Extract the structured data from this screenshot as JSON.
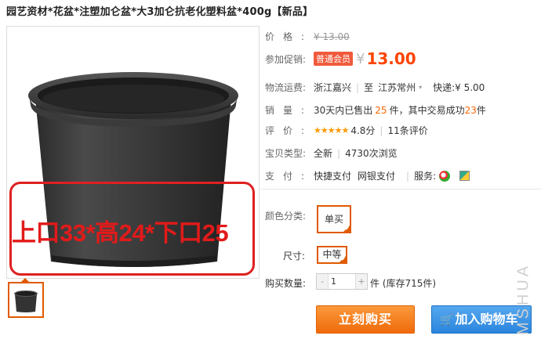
{
  "title": "园艺资材*花盆*注塑加仑盆*大3加仑抗老化塑料盆*400g【新品】",
  "image": {
    "overlay_text": "上口33*高24*下口25"
  },
  "details": {
    "price": {
      "label": "价格:",
      "value": "¥ 13.00"
    },
    "promo": {
      "label": "参加促销:",
      "badge": "普通会员",
      "currency": "¥",
      "value": "13.00"
    },
    "shipping": {
      "label": "物流运费:",
      "from": "浙江嘉兴",
      "to_word": "至",
      "to": "江苏常州",
      "express": "快递:¥ 5.00"
    },
    "sales": {
      "label": "销量:",
      "prefix": "30天内已售出",
      "count": "25",
      "mid": "件，其中交易成功",
      "success": "23",
      "suffix": "件"
    },
    "rating": {
      "label": "评价:",
      "stars": "★★★★★",
      "score": "4.8分",
      "reviews": "11条评价"
    },
    "type": {
      "label": "宝贝类型:",
      "value": "全新",
      "views": "4730次浏览"
    },
    "payment": {
      "label": "支付:",
      "methods": [
        "快捷支付",
        "网银支付"
      ],
      "service_label": "服务:"
    }
  },
  "sku": {
    "color_label": "颜色分类:",
    "color_value": "单买",
    "size_label": "尺寸:",
    "size_value": "中等"
  },
  "quantity": {
    "label": "购买数量:",
    "value": "1",
    "stock": "件 (库存715件)"
  },
  "buttons": {
    "buy_now": "立刻购买",
    "add_cart": "加入购物车"
  },
  "watermark": "MSHUA",
  "colors": {
    "accent": "#e05a00",
    "price": "#ff4400",
    "buy": "#ef6a0a",
    "cart": "#2a86dd"
  }
}
